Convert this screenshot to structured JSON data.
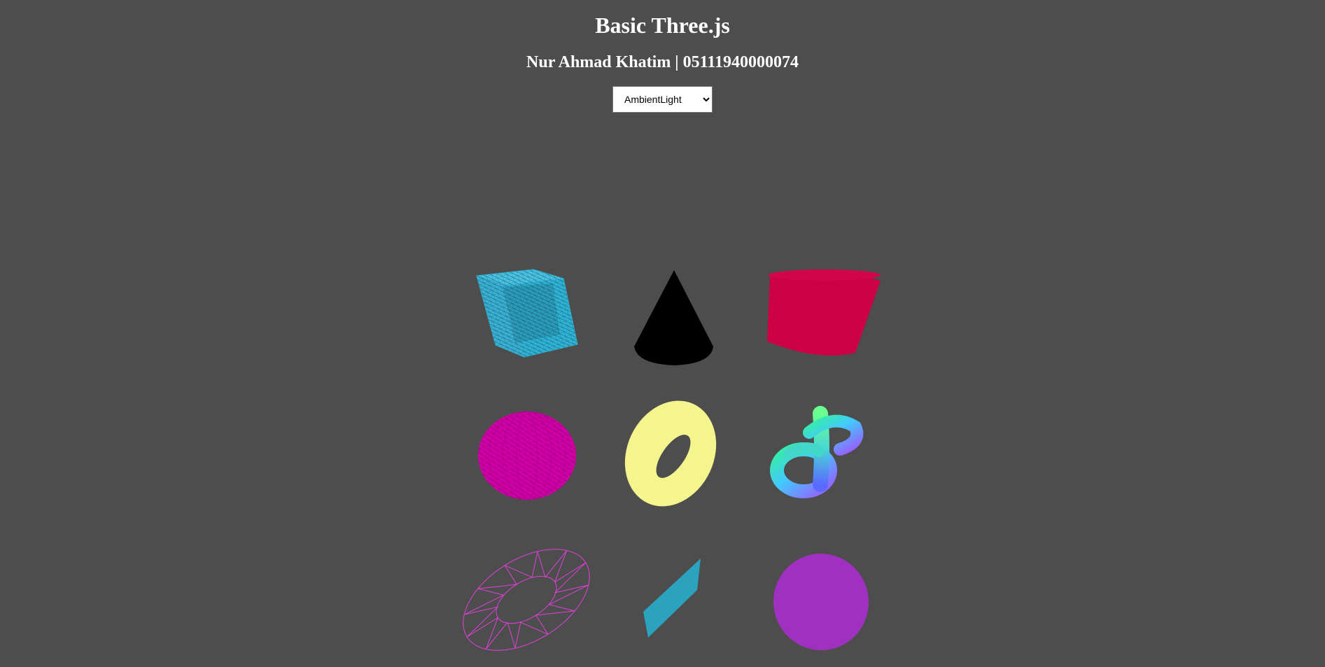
{
  "header": {
    "title": "Basic Three.js",
    "subtitle": "Nur Ahmad Khatim | 05111940000074"
  },
  "light_select": {
    "selected": "AmbientLight",
    "options": [
      "AmbientLight"
    ]
  },
  "objects": [
    {
      "name": "wireframe-box",
      "color": "#2fb6d8"
    },
    {
      "name": "cone",
      "color": "#000000"
    },
    {
      "name": "cylinder",
      "color": "#cc0044"
    },
    {
      "name": "wireframe-sphere",
      "color": "#d200a8"
    },
    {
      "name": "torus",
      "color": "#f5f58e"
    },
    {
      "name": "torus-knot",
      "color": "normal-material-gradient"
    },
    {
      "name": "wireframe-ring",
      "color": "#e040d8"
    },
    {
      "name": "plane",
      "color": "#2ba3bf"
    },
    {
      "name": "circle",
      "color": "#a030c0"
    }
  ]
}
